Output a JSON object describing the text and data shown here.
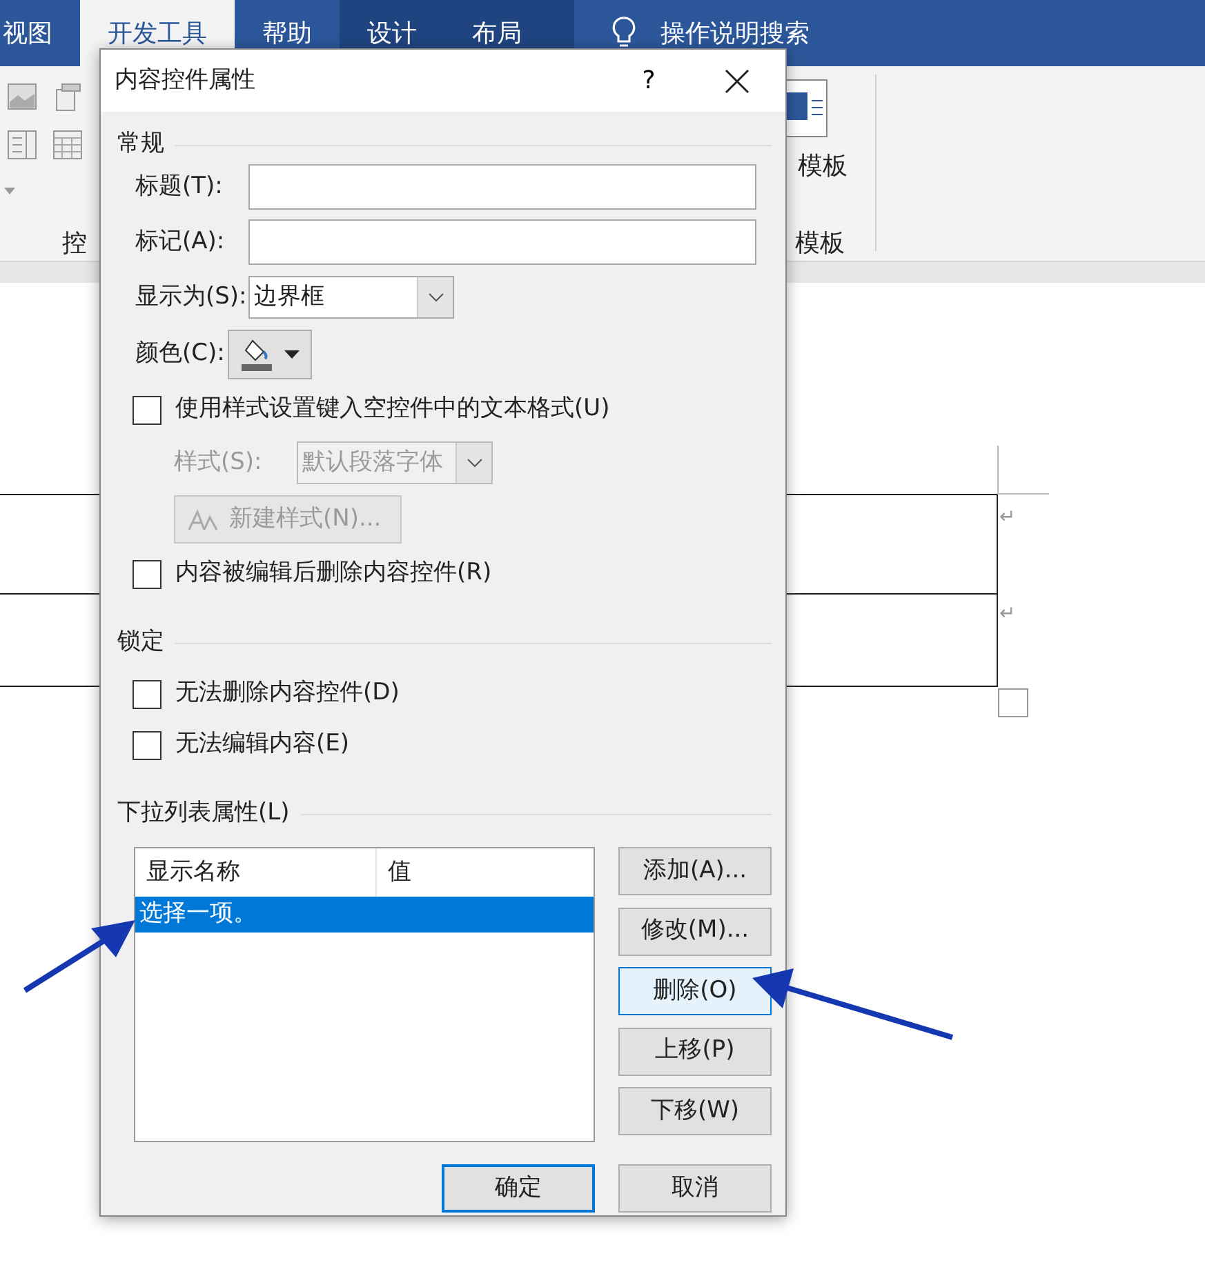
{
  "ribbon": {
    "tabs": [
      {
        "label": "视图",
        "selected": false,
        "kind": "normal"
      },
      {
        "label": "开发工具",
        "selected": true,
        "kind": "normal"
      },
      {
        "label": "帮助",
        "selected": false,
        "kind": "normal"
      },
      {
        "label": "设计",
        "selected": false,
        "kind": "contextual"
      },
      {
        "label": "布局",
        "selected": false,
        "kind": "contextual"
      }
    ],
    "search": "操作说明搜索",
    "template_button": "模板",
    "group_labels": [
      "控",
      "模板"
    ]
  },
  "document": {
    "paragraph_marks": [
      "↵",
      "↵"
    ]
  },
  "dialog": {
    "title": "内容控件属性",
    "help_button": "?",
    "general": {
      "heading": "常规",
      "items": [
        {
          "kind": "text",
          "label": "标题(T):"
        },
        {
          "kind": "text",
          "label": "标记(A):"
        },
        {
          "kind": "select",
          "label": "显示为(S):",
          "value": "边界框"
        },
        {
          "kind": "color",
          "label": "颜色(C):"
        },
        {
          "kind": "checkbox",
          "label": "使用样式设置键入空控件中的文本格式(U)",
          "checked": false
        },
        {
          "kind": "select",
          "label": "样式(S):",
          "value": "默认段落字体",
          "disabled": true
        },
        {
          "kind": "button",
          "label": "新建样式(N)...",
          "disabled": true
        },
        {
          "kind": "checkbox",
          "label": "内容被编辑后删除内容控件(R)",
          "checked": false
        }
      ]
    },
    "locking": {
      "heading": "锁定",
      "items": [
        {
          "kind": "checkbox",
          "label": "无法删除内容控件(D)",
          "checked": false
        },
        {
          "kind": "checkbox",
          "label": "无法编辑内容(E)",
          "checked": false
        }
      ]
    },
    "dropdown": {
      "heading": "下拉列表属性(L)",
      "columns": [
        "显示名称",
        "值"
      ],
      "rows": [
        {
          "display_name": "选择一项。",
          "selected": true
        }
      ],
      "buttons": [
        {
          "label": "添加(A)...",
          "focused": false
        },
        {
          "label": "修改(M)...",
          "focused": false
        },
        {
          "label": "删除(O)",
          "focused": true
        },
        {
          "label": "上移(P)",
          "focused": false
        },
        {
          "label": "下移(W)",
          "focused": false
        }
      ]
    },
    "footer_buttons": [
      {
        "label": "确定",
        "default": true
      },
      {
        "label": "取消",
        "default": false
      }
    ]
  }
}
